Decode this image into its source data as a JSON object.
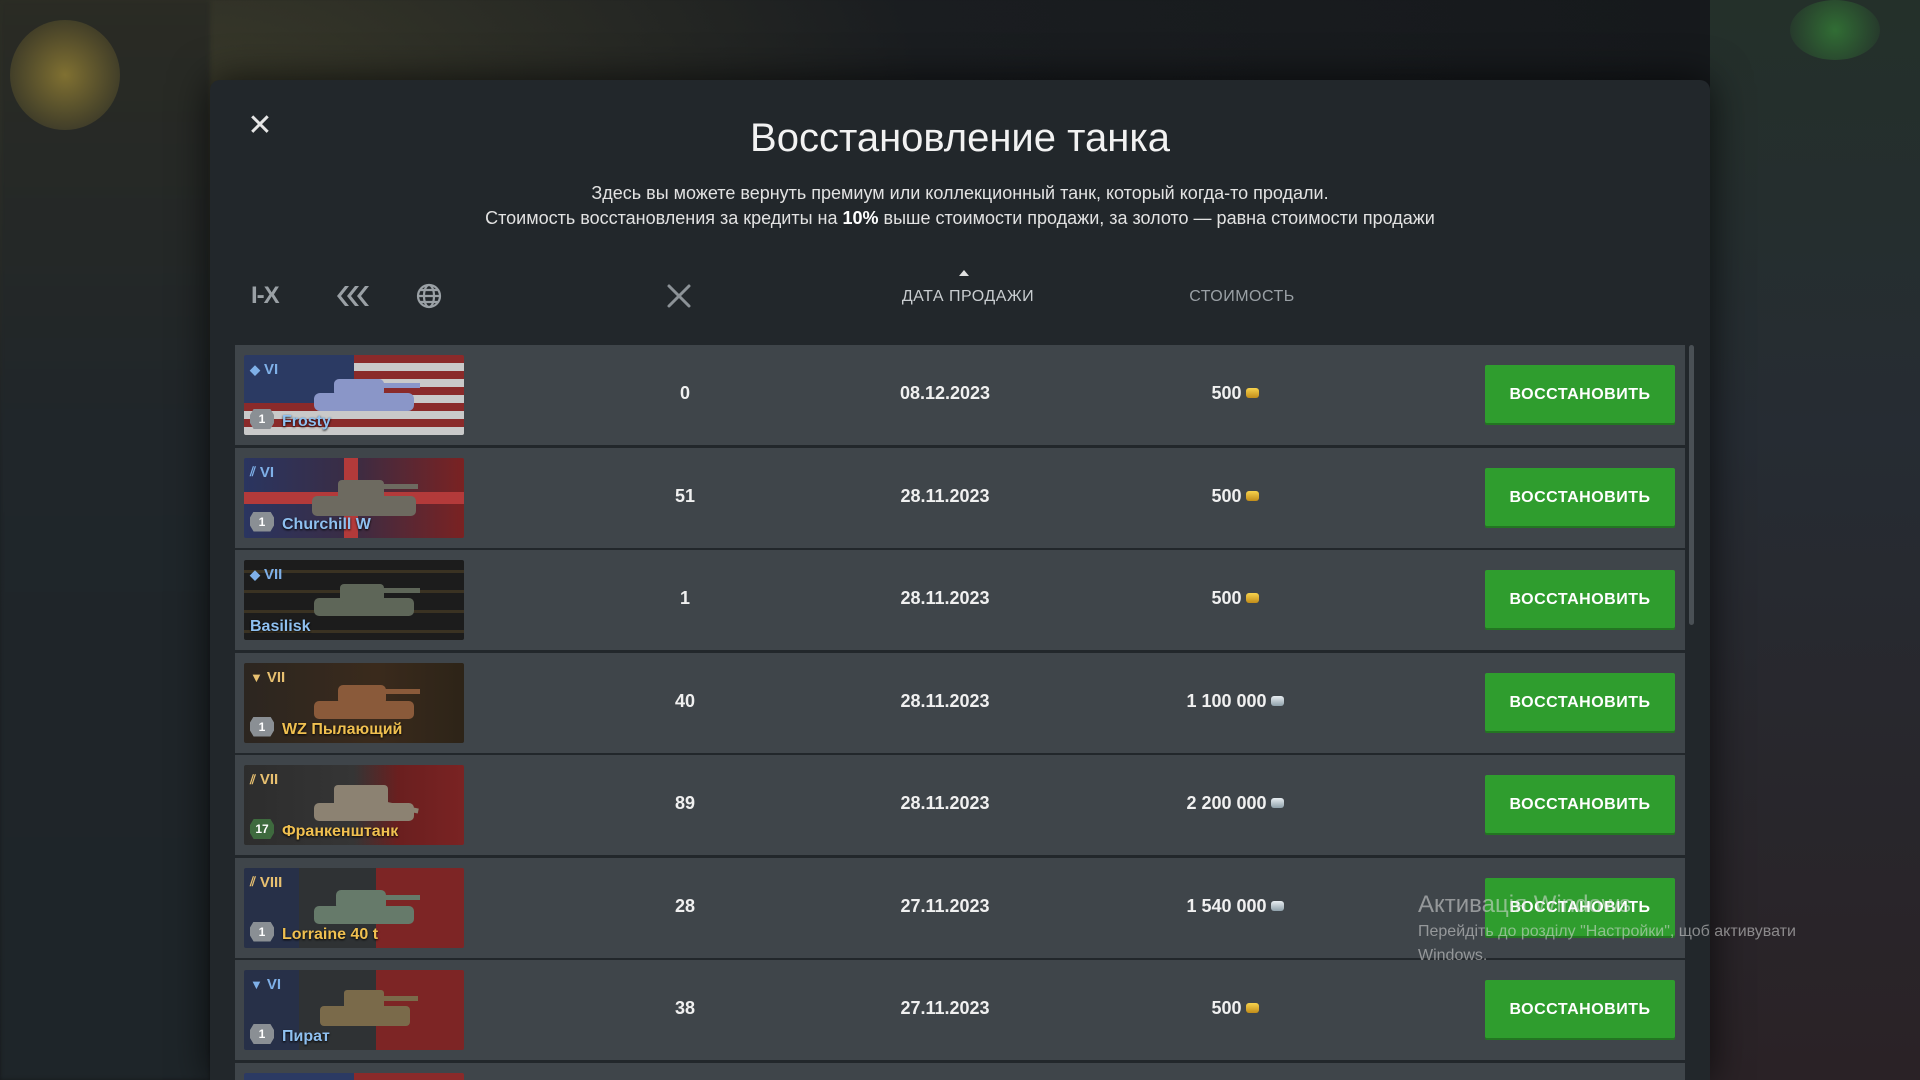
{
  "dialog": {
    "title": "Восстановление танка",
    "description_line1": "Здесь вы можете вернуть премиум или коллекционный танк, который когда-то продали.",
    "description_line2_before": "Стоимость восстановления за кредиты на ",
    "description_line2_bold": "10%",
    "description_line2_after": " выше стоимости продажи, за золото — равна стоимости продажи"
  },
  "filters": {
    "tier_label": "I-X",
    "type_icon": "tank-type-icon",
    "nation_icon": "globe-icon"
  },
  "columns": {
    "battles_icon": "crossed-swords-icon",
    "date": "ДАТА ПРОДАЖИ",
    "cost": "СТОИМОСТЬ"
  },
  "button_label": "ВОССТАНОВИТЬ",
  "tanks": [
    {
      "tier": "VI",
      "name": "Frosty",
      "mastery": "1",
      "battles": "0",
      "date": "08.12.2023",
      "cost": "500",
      "currency": "gold"
    },
    {
      "tier": "VI",
      "name": "Churchill W",
      "mastery": "1",
      "battles": "51",
      "date": "28.11.2023",
      "cost": "500",
      "currency": "gold"
    },
    {
      "tier": "VII",
      "name": "Basilisk",
      "mastery": "",
      "battles": "1",
      "date": "28.11.2023",
      "cost": "500",
      "currency": "gold"
    },
    {
      "tier": "VII",
      "name": "WZ Пылающий",
      "mastery": "1",
      "battles": "40",
      "date": "28.11.2023",
      "cost": "1 100 000",
      "currency": "silver"
    },
    {
      "tier": "VII",
      "name": "Франкенштанк",
      "mastery": "17",
      "battles": "89",
      "date": "28.11.2023",
      "cost": "2 200 000",
      "currency": "silver"
    },
    {
      "tier": "VIII",
      "name": "Lorraine 40 t",
      "mastery": "1",
      "battles": "28",
      "date": "27.11.2023",
      "cost": "1 540 000",
      "currency": "silver"
    },
    {
      "tier": "VI",
      "name": "Пират",
      "mastery": "1",
      "battles": "38",
      "date": "27.11.2023",
      "cost": "500",
      "currency": "gold"
    }
  ],
  "watermark": {
    "title": "Активація Windows",
    "line1": "Перейдіть до розділу \"Настройки\", щоб активувати",
    "line2": "Windows."
  },
  "colors": {
    "button_green": "#2f9d2e",
    "modal_bg": "#22272b",
    "row_bg": "#42484d",
    "premium_blue": "#8fc0f0",
    "collector_gold": "#f0c050"
  }
}
